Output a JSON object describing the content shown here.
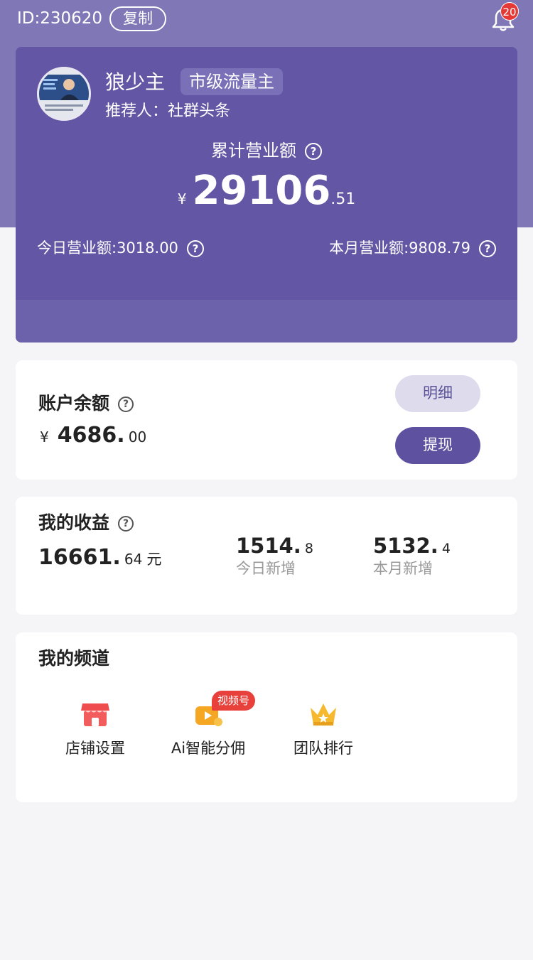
{
  "header": {
    "id_text": "ID:230620",
    "copy_label": "复制",
    "notification_count": "20"
  },
  "profile": {
    "name": "狼少主",
    "level": "市级流量主",
    "referrer": "推荐人：社群头条",
    "total_label": "累计营业额",
    "total_currency": "¥",
    "total_int": "29106",
    "total_dec": ".51",
    "today_revenue": "今日营业额:3018.00",
    "month_revenue": "本月营业额:9808.79"
  },
  "balance": {
    "title": "账户余额",
    "currency": "¥",
    "amount_int": "4686.",
    "amount_dec": "00",
    "detail_label": "明细",
    "withdraw_label": "提现"
  },
  "income": {
    "title": "我的收益",
    "total_int": "16661.",
    "total_dec": "64",
    "unit": "元",
    "today_int": "1514.",
    "today_dec": "8",
    "today_label": "今日新增",
    "month_int": "5132.",
    "month_dec": "4",
    "month_label": "本月新增"
  },
  "channels": {
    "title": "我的频道",
    "items": [
      {
        "label": "店铺设置",
        "icon": "store-icon"
      },
      {
        "label": "Ai智能分佣",
        "icon": "video-commission-icon",
        "badge": "视频号"
      },
      {
        "label": "团队排行",
        "icon": "crown-icon"
      }
    ]
  },
  "colors": {
    "primary": "#6357a5",
    "top_bg": "#7f77b6",
    "badge_red": "#e8403a"
  }
}
